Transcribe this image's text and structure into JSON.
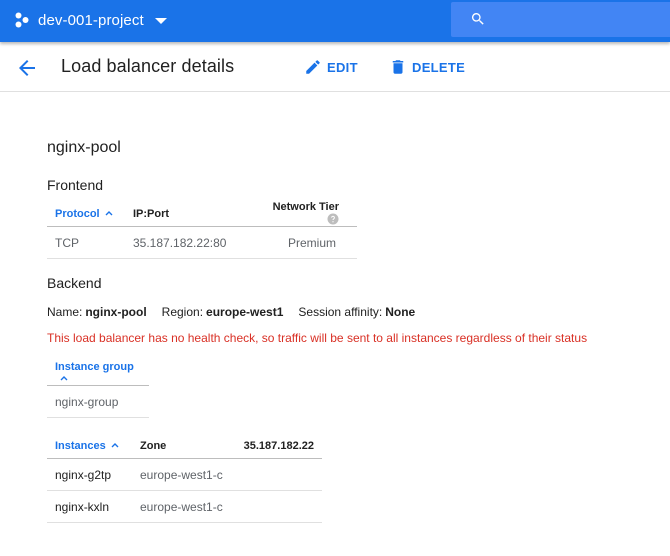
{
  "app_bar": {
    "project_name": "dev-001-project",
    "project_icon": "project-dots-icon",
    "search_placeholder": ""
  },
  "header": {
    "title": "Load balancer details",
    "edit_label": "EDIT",
    "delete_label": "DELETE"
  },
  "load_balancer": {
    "name": "nginx-pool"
  },
  "frontend": {
    "section_title": "Frontend",
    "columns": [
      "Protocol",
      "IP:Port",
      "Network Tier"
    ],
    "rows": [
      {
        "protocol": "TCP",
        "ip_port": "35.187.182.22:80",
        "tier": "Premium"
      }
    ]
  },
  "backend": {
    "section_title": "Backend",
    "name_label": "Name:",
    "name_value": "nginx-pool",
    "region_label": "Region:",
    "region_value": "europe-west1",
    "affinity_label": "Session affinity:",
    "affinity_value": "None",
    "warning": "This load balancer has no health check, so traffic will be sent to all instances regardless of their status",
    "group_table": {
      "column": "Instance group",
      "rows": [
        "nginx-group"
      ]
    },
    "instances_table": {
      "columns": [
        "Instances",
        "Zone",
        "35.187.182.22"
      ],
      "rows": [
        {
          "name": "nginx-g2tp",
          "zone": "europe-west1-c",
          "ip": ""
        },
        {
          "name": "nginx-kxln",
          "zone": "europe-west1-c",
          "ip": ""
        }
      ]
    }
  },
  "colors": {
    "appbar": "#1a73e8",
    "search_bg": "#4285f4",
    "accent": "#1a73e8",
    "warning": "#d93025"
  }
}
